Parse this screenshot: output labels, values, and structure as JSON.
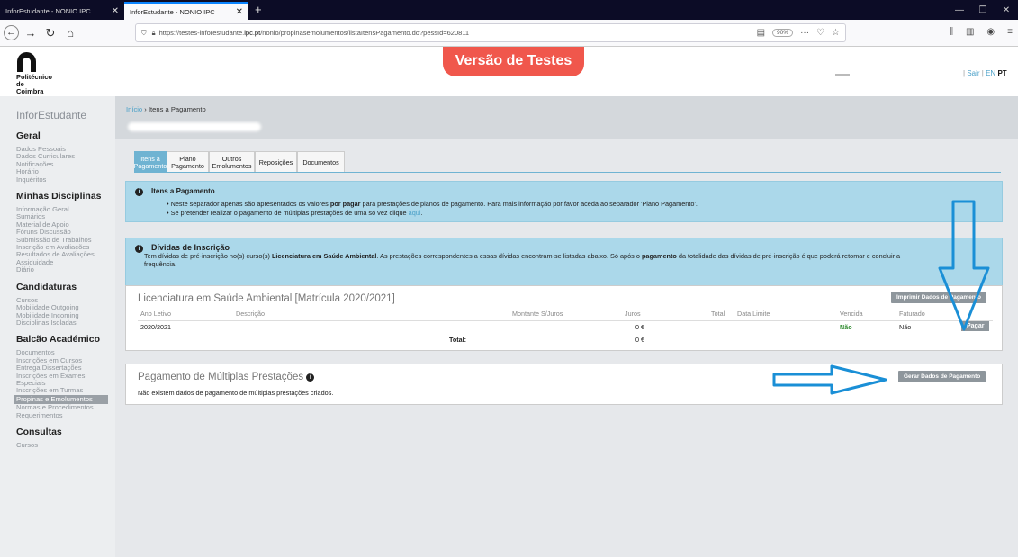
{
  "browser": {
    "tabs": [
      {
        "title": "InforEstudante - NONIO IPC"
      },
      {
        "title": "InforEstudante - NONIO IPC"
      }
    ],
    "url_prefix": "https://testes-inforestudante.",
    "url_domain": "ipc.pt",
    "url_suffix": "/nonio/propinasemolumentos/listaItensPagamento.do?pessId=620811",
    "zoom": "90%"
  },
  "header": {
    "logo_line1": "Politécnico",
    "logo_line2": "de Coimbra",
    "banner": "Versão de Testes",
    "sair": "Sair",
    "lang_en": "EN",
    "lang_pt": "PT"
  },
  "sidebar": {
    "title": "InforEstudante",
    "sections": [
      {
        "title": "Geral",
        "items": [
          "Dados Pessoais",
          "Dados Curriculares",
          "Notificações",
          "Horário",
          "Inquéritos"
        ]
      },
      {
        "title": "Minhas Disciplinas",
        "items": [
          "Informação Geral",
          "Sumários",
          "Material de Apoio",
          "Fóruns Discussão",
          "Submissão de Trabalhos",
          "Inscrição em Avaliações",
          "Resultados de Avaliações",
          "Assiduidade",
          "Diário"
        ]
      },
      {
        "title": "Candidaturas",
        "items": [
          "Cursos",
          "Mobilidade Outgoing",
          "Mobilidade Incoming",
          "Disciplinas Isoladas"
        ]
      },
      {
        "title": "Balcão Académico",
        "items": [
          "Documentos",
          "Inscrições em Cursos",
          "Entrega Dissertações",
          "Inscrições em Exames Especiais",
          "Inscrições em Turmas",
          "Propinas e Emolumentos",
          "Normas e Procedimentos",
          "Requerimentos"
        ]
      },
      {
        "title": "Consultas",
        "items": [
          "Cursos"
        ]
      }
    ],
    "active_item": "Propinas e Emolumentos"
  },
  "breadcrumb": {
    "home": "Início",
    "sep": "›",
    "current": "Itens a Pagamento"
  },
  "tabs": [
    {
      "line1": "Itens a",
      "line2": "Pagamento"
    },
    {
      "line1": "Plano",
      "line2": "Pagamento"
    },
    {
      "line1": "Outros",
      "line2": "Emolumentos"
    },
    {
      "line1": "Reposições",
      "line2": ""
    },
    {
      "line1": "Documentos",
      "line2": ""
    }
  ],
  "info1": {
    "title": "Itens a Pagamento",
    "b1_pre": "Neste separador apenas são apresentados os valores ",
    "b1_bold": "por pagar",
    "b1_post": " para prestações de planos de pagamento. Para mais informação por favor aceda ao separador 'Plano Pagamento'.",
    "b2_pre": "Se pretender realizar o pagamento de múltiplas prestações de uma só vez clique ",
    "b2_link": "aqui",
    "b2_post": "."
  },
  "info2": {
    "title": "Dívidas de Inscrição",
    "p1": "Tem dívidas de pré-inscrição no(s) curso(s) ",
    "course": "Licenciatura em Saúde Ambiental",
    "p2": ". As prestações correspondentes a essas dívidas encontram-se listadas abaixo. Só após o ",
    "bold2": "pagamento",
    "p3": " da totalidade das dívidas de pré-inscrição é que poderá retomar e concluir a ",
    "p4": "frequência."
  },
  "panel1": {
    "title": "Licenciatura em Saúde Ambiental [Matrícula 2020/2021]",
    "print_button": "Imprimir Dados de Pagamento",
    "headers": {
      "ano": "Ano Letivo",
      "desc": "Descrição",
      "montante": "Montante S/Juros",
      "juros": "Juros",
      "total": "Total",
      "data": "Data Limite",
      "vencida": "Vencida",
      "faturado": "Faturado"
    },
    "row": {
      "ano": "2020/2021",
      "juros": "0 €",
      "vencida": "Não",
      "faturado": "Não"
    },
    "pay_button": "Pagar",
    "total_label": "Total:",
    "total_juros": "0 €"
  },
  "panel2": {
    "title": "Pagamento de Múltiplas Prestações",
    "button": "Gerar Dados de Pagamento",
    "empty": "Não existem dados de pagamento de múltiplas prestações criados."
  },
  "colors": {
    "accent": "#6fb3d2",
    "info": "#abd8ea",
    "banner": "#f0574c",
    "arrow": "#1a8fd6"
  },
  "icons": [
    "back-icon",
    "forward-icon",
    "reload-icon",
    "home-icon",
    "shield-icon",
    "lock-icon",
    "reader-icon",
    "more-icon",
    "pocket-icon",
    "star-icon",
    "library-icon",
    "sidebar-icon",
    "account-icon",
    "menu-icon",
    "info-icon",
    "arrow-down-icon",
    "arrow-right-icon"
  ]
}
